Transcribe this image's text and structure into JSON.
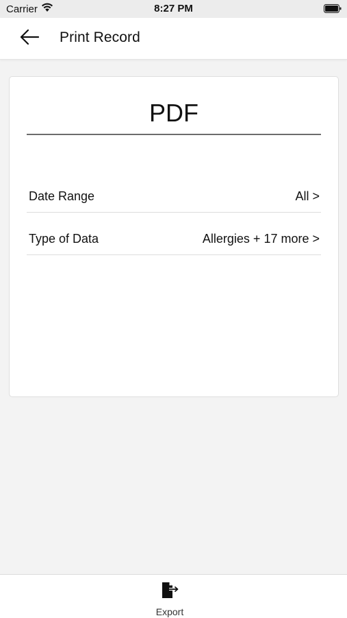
{
  "status_bar": {
    "carrier": "Carrier",
    "time": "8:27 PM",
    "wifi_icon": "wifi-icon",
    "battery_icon": "battery-full-icon"
  },
  "header": {
    "back_icon": "arrow-left-icon",
    "title": "Print Record"
  },
  "card": {
    "format_title": "PDF",
    "options": [
      {
        "label": "Date Range",
        "value": "All >"
      },
      {
        "label": "Type of Data",
        "value": "Allergies + 17 more >"
      }
    ]
  },
  "bottom_bar": {
    "export_icon": "export-icon",
    "export_label": "Export"
  },
  "colors": {
    "background": "#f3f3f3",
    "card": "#ffffff",
    "status_bar": "#ececec",
    "text": "#111111"
  }
}
